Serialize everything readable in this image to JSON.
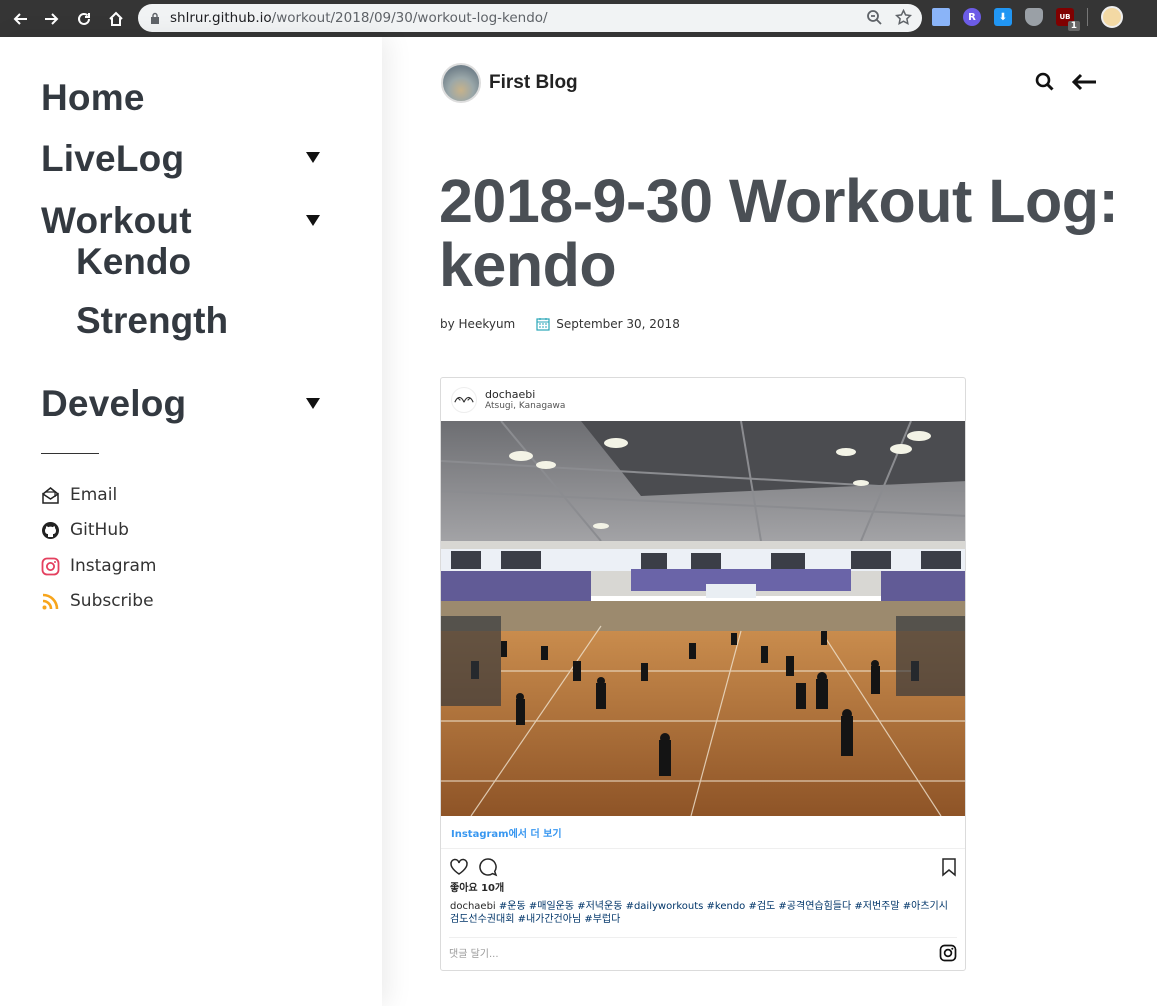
{
  "browser": {
    "url_host": "shlrur.github.io",
    "url_path": "/workout/2018/09/30/workout-log-kendo/",
    "ext_badge": "1",
    "ext_labels": [
      "R",
      "UB"
    ]
  },
  "sidebar": {
    "nav": [
      {
        "label": "Home"
      },
      {
        "label": "LiveLog"
      },
      {
        "label": "Workout"
      },
      {
        "label": "Kendo"
      },
      {
        "label": "Strength"
      },
      {
        "label": "Develog"
      }
    ],
    "social": [
      {
        "label": "Email",
        "icon": "email-icon"
      },
      {
        "label": "GitHub",
        "icon": "github-icon"
      },
      {
        "label": "Instagram",
        "icon": "instagram-icon"
      },
      {
        "label": "Subscribe",
        "icon": "rss-icon"
      }
    ]
  },
  "header": {
    "brand_title": "First Blog"
  },
  "post": {
    "title": "2018-9-30 Workout Log: kendo",
    "author": "by Heekyum",
    "date": "September 30, 2018"
  },
  "instagram": {
    "username": "dochaebi",
    "location": "Atsugi, Kanagawa",
    "view_more": "Instagram에서 더 보기",
    "likes": "좋아요 10개",
    "caption_user": "dochaebi",
    "caption_tags": "#운동 #매일운동 #저녁운동 #dailyworkouts #kendo #검도 #공격연습힘들다 #저번주말 #아츠기시검도선수권대회 #내가간건아님 #부럽다",
    "comment_placeholder": "댓글 달기..."
  },
  "colors": {
    "nav_text": "#333940",
    "title_text": "#4a4f55",
    "ig_link": "#3897f0",
    "rss": "#f7a51c",
    "instagram": "#e4405f"
  }
}
